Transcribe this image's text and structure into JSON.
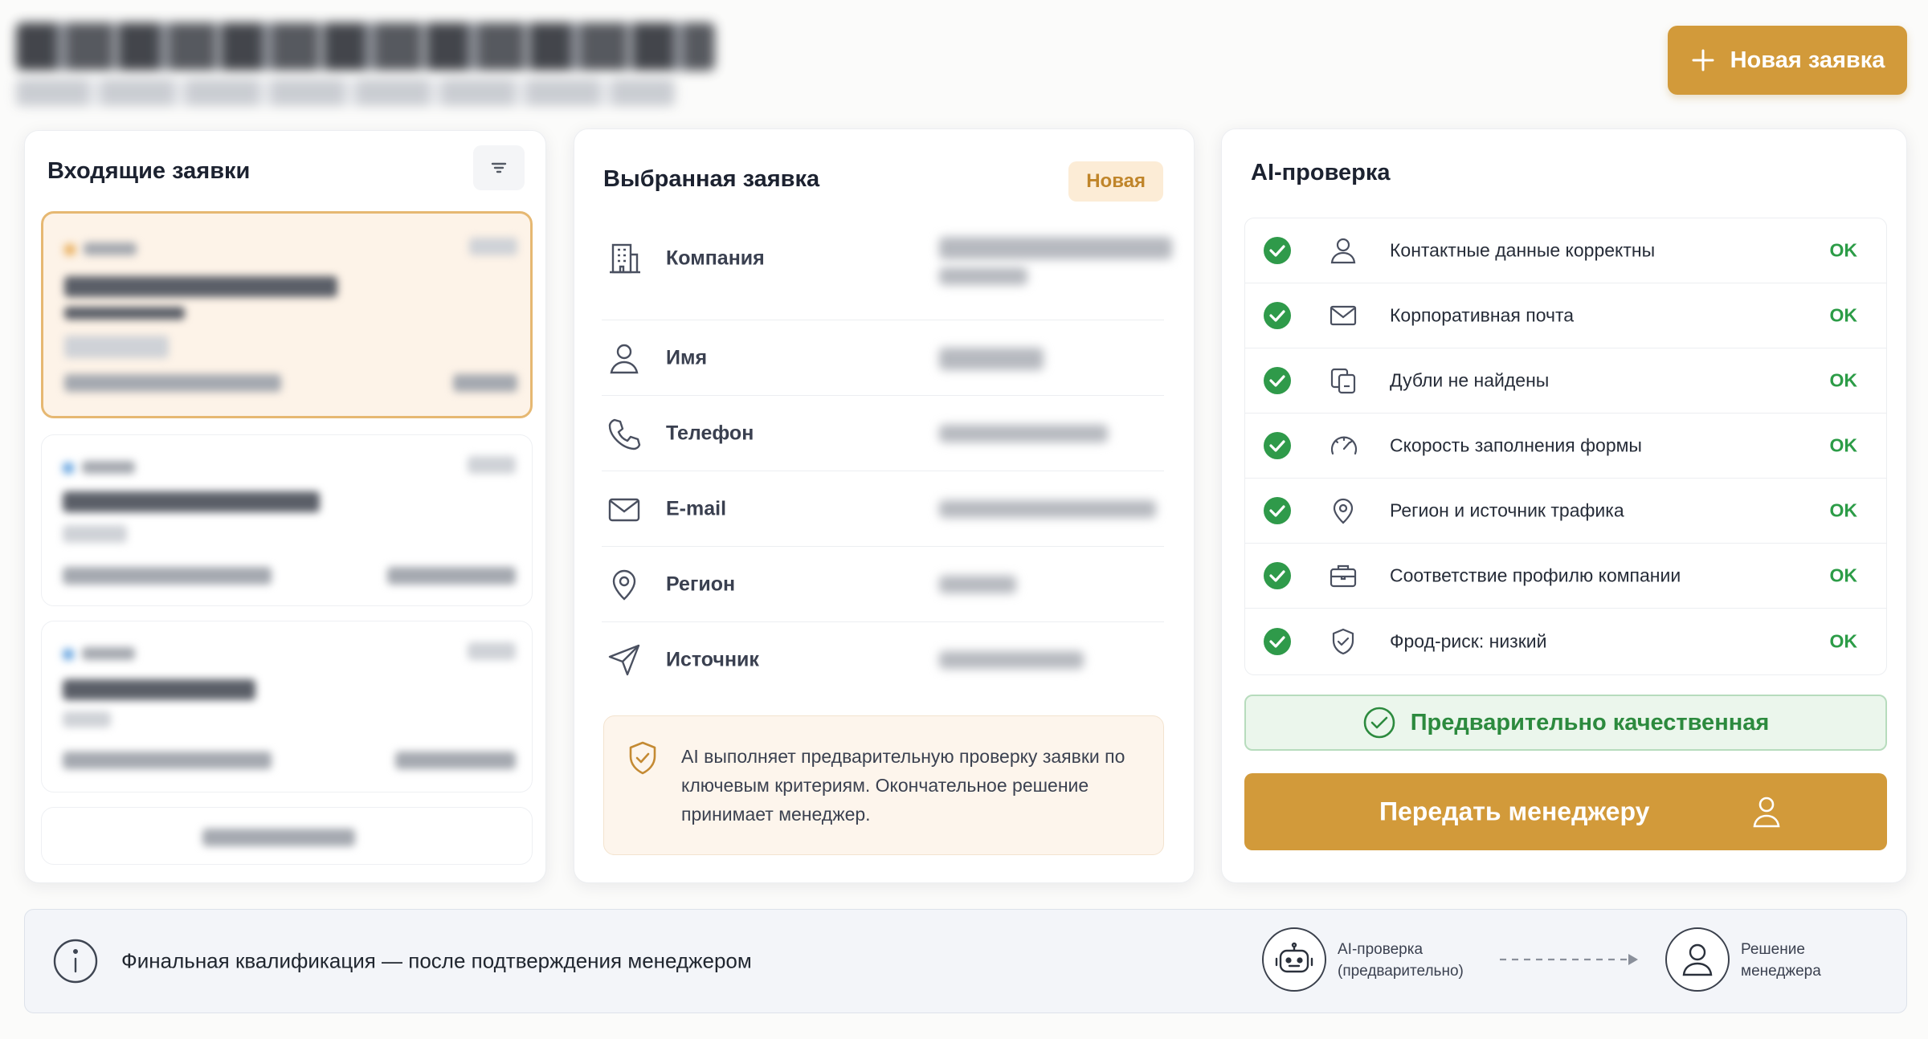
{
  "header": {
    "new_request_button": "Новая заявка"
  },
  "incoming": {
    "title": "Входящие заявки"
  },
  "selected": {
    "title": "Выбранная заявка",
    "status_badge": "Новая",
    "fields": [
      {
        "label": "Компания",
        "icon": "building-icon"
      },
      {
        "label": "Имя",
        "icon": "user-icon"
      },
      {
        "label": "Телефон",
        "icon": "phone-icon"
      },
      {
        "label": "E-mail",
        "icon": "mail-icon"
      },
      {
        "label": "Регион",
        "icon": "location-pin-icon"
      },
      {
        "label": "Источник",
        "icon": "send-icon"
      }
    ],
    "ai_note": "AI выполняет предварительную проверку заявки по ключевым критериям. Окончательное решение принимает менеджер."
  },
  "ai_check": {
    "title": "AI-проверка",
    "checks": [
      {
        "label": "Контактные данные корректны",
        "status": "OK",
        "icon": "user-icon"
      },
      {
        "label": "Корпоративная почта",
        "status": "OK",
        "icon": "mail-icon"
      },
      {
        "label": "Дубли не найдены",
        "status": "OK",
        "icon": "copy-icon"
      },
      {
        "label": "Скорость заполнения формы",
        "status": "OK",
        "icon": "speedometer-icon"
      },
      {
        "label": "Регион и источник трафика",
        "status": "OK",
        "icon": "location-pin-icon"
      },
      {
        "label": "Соответствие профилю компании",
        "status": "OK",
        "icon": "briefcase-icon"
      },
      {
        "label": "Фрод-риск: низкий",
        "status": "OK",
        "icon": "shield-check-icon"
      }
    ],
    "quality_label": "Предварительно качественная",
    "handoff_button": "Передать менеджеру"
  },
  "bottom": {
    "message": "Финальная квалификация — после подтверждения менеджером",
    "step_ai": "AI-проверка\n(предварительно)",
    "step_manager": "Решение\nменеджера"
  },
  "colors": {
    "accent": "#d29a3a",
    "ok_green": "#2c9c47",
    "badge_bg": "#fcecd6"
  }
}
